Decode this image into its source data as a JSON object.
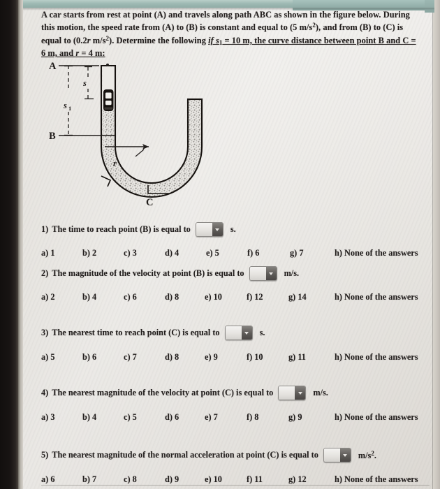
{
  "problem": {
    "line1": "A car starts from rest at point (A) and travels along path ABC as shown in the figure below. During",
    "line2": "this motion, the speed rate from (A) to (B) is constant and equal to (5 m/s",
    "line2b": "), and from (B) to (C) is",
    "line3a": "equal to (0.2",
    "line3b": " m/s",
    "line3c": "). Determine the following ",
    "line3_underlined": "if s",
    "line3_sub": "1",
    "line3_underlined2": " = 10 m, the curve distance between point B and C =",
    "line4_underlined": "6 m, and ",
    "line4_ital": "r",
    "line4_underlined2": " = 4 m:"
  },
  "figure": {
    "label_a": "A",
    "label_b": "B",
    "label_c": "C",
    "label_s": "s",
    "label_s1": "s",
    "label_s1_sub": "1",
    "label_r": "r",
    "description": "U-shaped track with car on the vertical segment between A and B, radius r to the center of the curve, point C at bottom of the U"
  },
  "questions": [
    {
      "number": "1)",
      "text_before": "The time to reach point (B) is equal to",
      "unit": "s.",
      "value": "",
      "options": [
        {
          "key": "a)",
          "label": "1"
        },
        {
          "key": "b)",
          "label": "2"
        },
        {
          "key": "c)",
          "label": "3"
        },
        {
          "key": "d)",
          "label": "4"
        },
        {
          "key": "e)",
          "label": "5"
        },
        {
          "key": "f)",
          "label": "6"
        },
        {
          "key": "g)",
          "label": "7"
        },
        {
          "key": "h)",
          "label": "None of the answers"
        }
      ]
    },
    {
      "number": "2)",
      "text_before": "The magnitude of the velocity at point (B) is equal to",
      "unit": "m/s.",
      "value": "",
      "options": [
        {
          "key": "a)",
          "label": "2"
        },
        {
          "key": "b)",
          "label": "4"
        },
        {
          "key": "c)",
          "label": "6"
        },
        {
          "key": "d)",
          "label": "8"
        },
        {
          "key": "e)",
          "label": "10"
        },
        {
          "key": "f)",
          "label": "12"
        },
        {
          "key": "g)",
          "label": "14"
        },
        {
          "key": "h)",
          "label": "None of the answers"
        }
      ]
    },
    {
      "number": "3)",
      "text_before": "The nearest time to reach point (C) is equal to",
      "unit": "s.",
      "value": "",
      "options": [
        {
          "key": "a)",
          "label": "5"
        },
        {
          "key": "b)",
          "label": "6"
        },
        {
          "key": "c)",
          "label": "7"
        },
        {
          "key": "d)",
          "label": "8"
        },
        {
          "key": "e)",
          "label": "9"
        },
        {
          "key": "f)",
          "label": "10"
        },
        {
          "key": "g)",
          "label": "11"
        },
        {
          "key": "h)",
          "label": "None of the answers"
        }
      ]
    },
    {
      "number": "4)",
      "text_before": "The nearest magnitude of the velocity at point (C) is equal to",
      "unit": "m/s.",
      "value": "",
      "options": [
        {
          "key": "a)",
          "label": "3"
        },
        {
          "key": "b)",
          "label": "4"
        },
        {
          "key": "c)",
          "label": "5"
        },
        {
          "key": "d)",
          "label": "6"
        },
        {
          "key": "e)",
          "label": "7"
        },
        {
          "key": "f)",
          "label": "8"
        },
        {
          "key": "g)",
          "label": "9"
        },
        {
          "key": "h)",
          "label": "None of the answers"
        }
      ]
    },
    {
      "number": "5)",
      "text_before": "The nearest magnitude of the normal acceleration at point (C) is equal to",
      "unit": "m/s",
      "unit_sup": "2",
      "unit_end": ".",
      "value": "",
      "options": [
        {
          "key": "a)",
          "label": "6"
        },
        {
          "key": "b)",
          "label": "7"
        },
        {
          "key": "c)",
          "label": "8"
        },
        {
          "key": "d)",
          "label": "9"
        },
        {
          "key": "e)",
          "label": "10"
        },
        {
          "key": "f)",
          "label": "11"
        },
        {
          "key": "g)",
          "label": "12"
        },
        {
          "key": "h)",
          "label": "None of the answers"
        }
      ]
    }
  ],
  "colors": {
    "paper": "#e4e1dc",
    "ink": "#221e1d",
    "chrome_teal": "#9fbab4",
    "bezel": "#161312"
  }
}
